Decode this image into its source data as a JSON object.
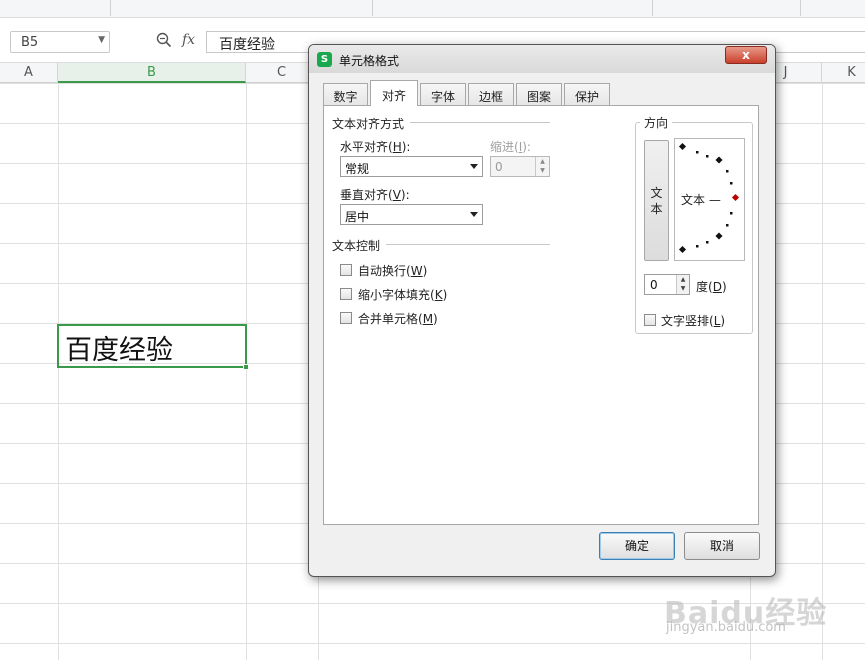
{
  "formula_bar": {
    "name_box": "B5",
    "fx_label": "fx",
    "content": "百度经验"
  },
  "columns": [
    "A",
    "B",
    "C",
    "J",
    "K"
  ],
  "active_column": "B",
  "cell": {
    "value": "百度经验"
  },
  "dialog": {
    "title": "单元格格式",
    "app_icon": "S",
    "close_label": "x",
    "tabs": [
      "数字",
      "对齐",
      "字体",
      "边框",
      "图案",
      "保护"
    ],
    "active_tab": "对齐",
    "text_alignment": {
      "title": "文本对齐方式",
      "horizontal_label": "水平对齐(",
      "horizontal_key": "H",
      "horizontal_value": "常规",
      "indent_label": "缩进(",
      "indent_key": "I",
      "indent_value": "0",
      "vertical_label": "垂直对齐(",
      "vertical_key": "V",
      "vertical_value": "居中"
    },
    "text_control": {
      "title": "文本控制",
      "options": [
        {
          "label": "自动换行(",
          "key": "W",
          "checked": false
        },
        {
          "label": "缩小字体填充(",
          "key": "K",
          "checked": false
        },
        {
          "label": "合并单元格(",
          "key": "M",
          "checked": false
        }
      ]
    },
    "orientation": {
      "title": "方向",
      "vertical_text_char1": "文",
      "vertical_text_char2": "本",
      "dial_text": "文本 —",
      "degrees_value": "0",
      "degrees_label": "度(",
      "degrees_key": "D",
      "vertical_stack_label": "文字竖排(",
      "vertical_stack_key": "L",
      "vertical_stack_checked": false
    },
    "buttons": {
      "ok": "确定",
      "cancel": "取消"
    }
  },
  "watermark": {
    "logo": "Baidu经验",
    "sub": "jingyan.baidu.com"
  }
}
